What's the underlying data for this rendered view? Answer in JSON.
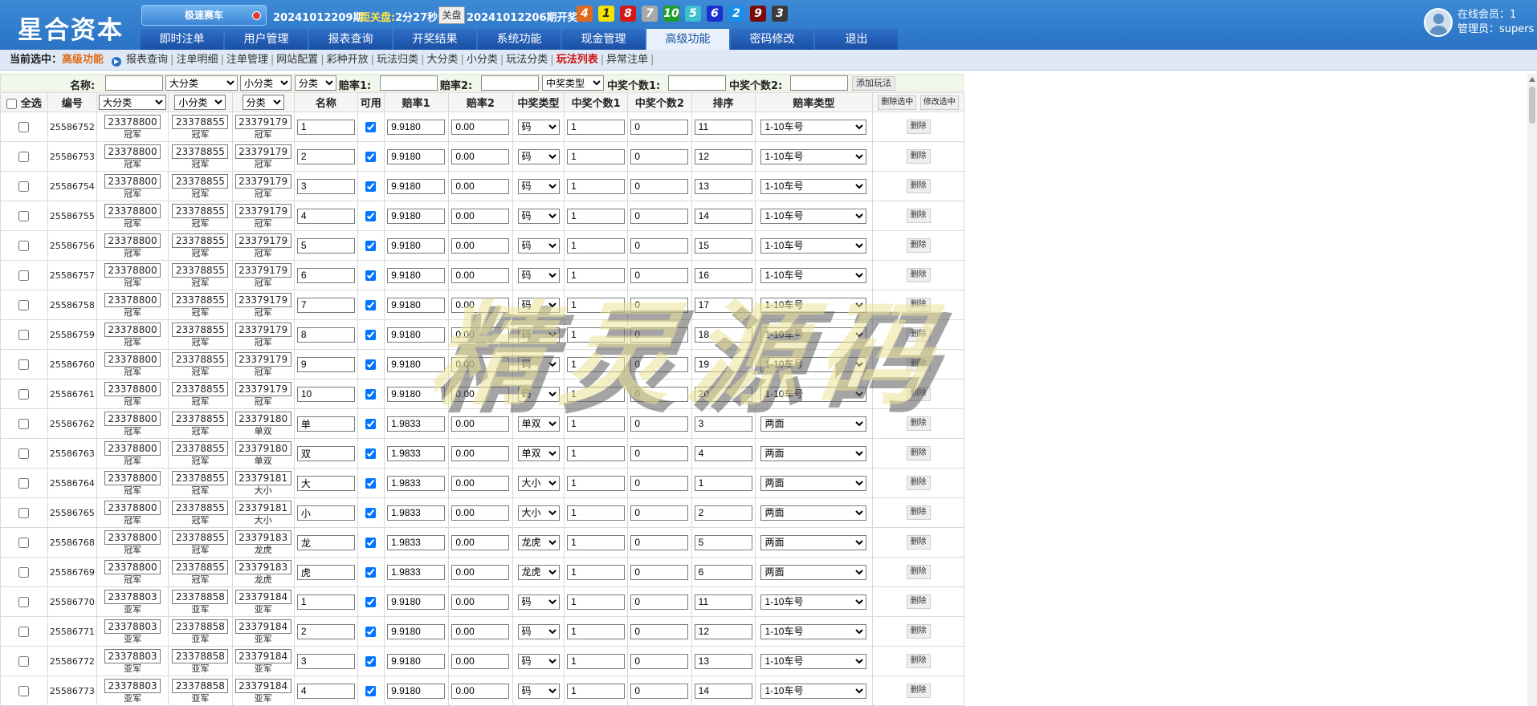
{
  "header": {
    "logo": "星合资本",
    "game": "极速赛车",
    "period": "20241012209期",
    "close_label": "距关盘:",
    "countdown": "2分27秒",
    "close_button": "关盘",
    "last_period": "20241012206期开奖:",
    "balls": [
      {
        "n": "4",
        "color": "#e46a1a"
      },
      {
        "n": "1",
        "color": "#f4e200"
      },
      {
        "n": "8",
        "color": "#d41818"
      },
      {
        "n": "7",
        "color": "#a8a8a8"
      },
      {
        "n": "10",
        "color": "#1f9e2a"
      },
      {
        "n": "5",
        "color": "#3cc0ce"
      },
      {
        "n": "6",
        "color": "#1a2fd0"
      },
      {
        "n": "2",
        "color": "#1a8ee8"
      },
      {
        "n": "9",
        "color": "#7a0a0a"
      },
      {
        "n": "3",
        "color": "#3a3a3a"
      }
    ],
    "online": "在线会员：1",
    "admin": "管理员：supers"
  },
  "nav": {
    "tabs": [
      "即时注单",
      "用户管理",
      "报表查询",
      "开奖结果",
      "系统功能",
      "现金管理",
      "高级功能",
      "密码修改",
      "退出"
    ],
    "active": "高级功能"
  },
  "subnav": {
    "label": "当前选中：",
    "current": "高级功能",
    "links": [
      "报表查询",
      "注单明细",
      "注单管理",
      "网站配置",
      "彩种开放",
      "玩法归类",
      "大分类",
      "小分类",
      "玩法分类",
      "玩法列表",
      "异常注单"
    ],
    "highlight": "玩法列表"
  },
  "addbar": {
    "name_label": "名称:",
    "cat1": "大分类",
    "cat2": "小分类",
    "cat3": "分类",
    "odds1_label": "赔率1:",
    "odds2_label": "赔率2:",
    "prize_type": "中奖类型",
    "count1_label": "中奖个数1:",
    "count2_label": "中奖个数2:",
    "add_button": "添加玩法"
  },
  "table": {
    "select_all": "全选",
    "headers": {
      "id": "编号",
      "cat1": "大分类",
      "cat2": "小分类",
      "cat3": "分类",
      "name": "名称",
      "enabled": "可用",
      "odds1": "赔率1",
      "odds2": "赔率2",
      "prize_type": "中奖类型",
      "count1": "中奖个数1",
      "count2": "中奖个数2",
      "sort": "排序",
      "odds_type": "赔率类型",
      "delete_selected": "删除选中",
      "edit_selected": "修改选中"
    },
    "delete_label": "删除",
    "rows": [
      {
        "id": "25586752",
        "c1": "23378800",
        "c1l": "冠军",
        "c2": "23378855",
        "c2l": "冠军",
        "c3": "23379179",
        "c3l": "冠军",
        "name": "1",
        "o1": "9.9180",
        "o2": "0.00",
        "pt": "码",
        "n1": "1",
        "n2": "0",
        "sort": "11",
        "ot": "1-10车号"
      },
      {
        "id": "25586753",
        "c1": "23378800",
        "c1l": "冠军",
        "c2": "23378855",
        "c2l": "冠军",
        "c3": "23379179",
        "c3l": "冠军",
        "name": "2",
        "o1": "9.9180",
        "o2": "0.00",
        "pt": "码",
        "n1": "1",
        "n2": "0",
        "sort": "12",
        "ot": "1-10车号"
      },
      {
        "id": "25586754",
        "c1": "23378800",
        "c1l": "冠军",
        "c2": "23378855",
        "c2l": "冠军",
        "c3": "23379179",
        "c3l": "冠军",
        "name": "3",
        "o1": "9.9180",
        "o2": "0.00",
        "pt": "码",
        "n1": "1",
        "n2": "0",
        "sort": "13",
        "ot": "1-10车号"
      },
      {
        "id": "25586755",
        "c1": "23378800",
        "c1l": "冠军",
        "c2": "23378855",
        "c2l": "冠军",
        "c3": "23379179",
        "c3l": "冠军",
        "name": "4",
        "o1": "9.9180",
        "o2": "0.00",
        "pt": "码",
        "n1": "1",
        "n2": "0",
        "sort": "14",
        "ot": "1-10车号"
      },
      {
        "id": "25586756",
        "c1": "23378800",
        "c1l": "冠军",
        "c2": "23378855",
        "c2l": "冠军",
        "c3": "23379179",
        "c3l": "冠军",
        "name": "5",
        "o1": "9.9180",
        "o2": "0.00",
        "pt": "码",
        "n1": "1",
        "n2": "0",
        "sort": "15",
        "ot": "1-10车号"
      },
      {
        "id": "25586757",
        "c1": "23378800",
        "c1l": "冠军",
        "c2": "23378855",
        "c2l": "冠军",
        "c3": "23379179",
        "c3l": "冠军",
        "name": "6",
        "o1": "9.9180",
        "o2": "0.00",
        "pt": "码",
        "n1": "1",
        "n2": "0",
        "sort": "16",
        "ot": "1-10车号"
      },
      {
        "id": "25586758",
        "c1": "23378800",
        "c1l": "冠军",
        "c2": "23378855",
        "c2l": "冠军",
        "c3": "23379179",
        "c3l": "冠军",
        "name": "7",
        "o1": "9.9180",
        "o2": "0.00",
        "pt": "码",
        "n1": "1",
        "n2": "0",
        "sort": "17",
        "ot": "1-10车号"
      },
      {
        "id": "25586759",
        "c1": "23378800",
        "c1l": "冠军",
        "c2": "23378855",
        "c2l": "冠军",
        "c3": "23379179",
        "c3l": "冠军",
        "name": "8",
        "o1": "9.9180",
        "o2": "0.00",
        "pt": "码",
        "n1": "1",
        "n2": "0",
        "sort": "18",
        "ot": "1-10车号"
      },
      {
        "id": "25586760",
        "c1": "23378800",
        "c1l": "冠军",
        "c2": "23378855",
        "c2l": "冠军",
        "c3": "23379179",
        "c3l": "冠军",
        "name": "9",
        "o1": "9.9180",
        "o2": "0.00",
        "pt": "码",
        "n1": "1",
        "n2": "0",
        "sort": "19",
        "ot": "1-10车号"
      },
      {
        "id": "25586761",
        "c1": "23378800",
        "c1l": "冠军",
        "c2": "23378855",
        "c2l": "冠军",
        "c3": "23379179",
        "c3l": "冠军",
        "name": "10",
        "o1": "9.9180",
        "o2": "0.00",
        "pt": "码",
        "n1": "1",
        "n2": "0",
        "sort": "20",
        "ot": "1-10车号"
      },
      {
        "id": "25586762",
        "c1": "23378800",
        "c1l": "冠军",
        "c2": "23378855",
        "c2l": "冠军",
        "c3": "23379180",
        "c3l": "单双",
        "name": "单",
        "o1": "1.9833",
        "o2": "0.00",
        "pt": "单双",
        "n1": "1",
        "n2": "0",
        "sort": "3",
        "ot": "两面"
      },
      {
        "id": "25586763",
        "c1": "23378800",
        "c1l": "冠军",
        "c2": "23378855",
        "c2l": "冠军",
        "c3": "23379180",
        "c3l": "单双",
        "name": "双",
        "o1": "1.9833",
        "o2": "0.00",
        "pt": "单双",
        "n1": "1",
        "n2": "0",
        "sort": "4",
        "ot": "两面"
      },
      {
        "id": "25586764",
        "c1": "23378800",
        "c1l": "冠军",
        "c2": "23378855",
        "c2l": "冠军",
        "c3": "23379181",
        "c3l": "大小",
        "name": "大",
        "o1": "1.9833",
        "o2": "0.00",
        "pt": "大小",
        "n1": "1",
        "n2": "0",
        "sort": "1",
        "ot": "两面"
      },
      {
        "id": "25586765",
        "c1": "23378800",
        "c1l": "冠军",
        "c2": "23378855",
        "c2l": "冠军",
        "c3": "23379181",
        "c3l": "大小",
        "name": "小",
        "o1": "1.9833",
        "o2": "0.00",
        "pt": "大小",
        "n1": "1",
        "n2": "0",
        "sort": "2",
        "ot": "两面"
      },
      {
        "id": "25586768",
        "c1": "23378800",
        "c1l": "冠军",
        "c2": "23378855",
        "c2l": "冠军",
        "c3": "23379183",
        "c3l": "龙虎",
        "name": "龙",
        "o1": "1.9833",
        "o2": "0.00",
        "pt": "龙虎",
        "n1": "1",
        "n2": "0",
        "sort": "5",
        "ot": "两面"
      },
      {
        "id": "25586769",
        "c1": "23378800",
        "c1l": "冠军",
        "c2": "23378855",
        "c2l": "冠军",
        "c3": "23379183",
        "c3l": "龙虎",
        "name": "虎",
        "o1": "1.9833",
        "o2": "0.00",
        "pt": "龙虎",
        "n1": "1",
        "n2": "0",
        "sort": "6",
        "ot": "两面"
      },
      {
        "id": "25586770",
        "c1": "23378803",
        "c1l": "亚军",
        "c2": "23378858",
        "c2l": "亚军",
        "c3": "23379184",
        "c3l": "亚军",
        "name": "1",
        "o1": "9.9180",
        "o2": "0.00",
        "pt": "码",
        "n1": "1",
        "n2": "0",
        "sort": "11",
        "ot": "1-10车号"
      },
      {
        "id": "25586771",
        "c1": "23378803",
        "c1l": "亚军",
        "c2": "23378858",
        "c2l": "亚军",
        "c3": "23379184",
        "c3l": "亚军",
        "name": "2",
        "o1": "9.9180",
        "o2": "0.00",
        "pt": "码",
        "n1": "1",
        "n2": "0",
        "sort": "12",
        "ot": "1-10车号"
      },
      {
        "id": "25586772",
        "c1": "23378803",
        "c1l": "亚军",
        "c2": "23378858",
        "c2l": "亚军",
        "c3": "23379184",
        "c3l": "亚军",
        "name": "3",
        "o1": "9.9180",
        "o2": "0.00",
        "pt": "码",
        "n1": "1",
        "n2": "0",
        "sort": "13",
        "ot": "1-10车号"
      },
      {
        "id": "25586773",
        "c1": "23378803",
        "c1l": "亚军",
        "c2": "23378858",
        "c2l": "亚军",
        "c3": "23379184",
        "c3l": "亚军",
        "name": "4",
        "o1": "9.9180",
        "o2": "0.00",
        "pt": "码",
        "n1": "1",
        "n2": "0",
        "sort": "14",
        "ot": "1-10车号"
      }
    ]
  },
  "watermark": "精灵源码"
}
